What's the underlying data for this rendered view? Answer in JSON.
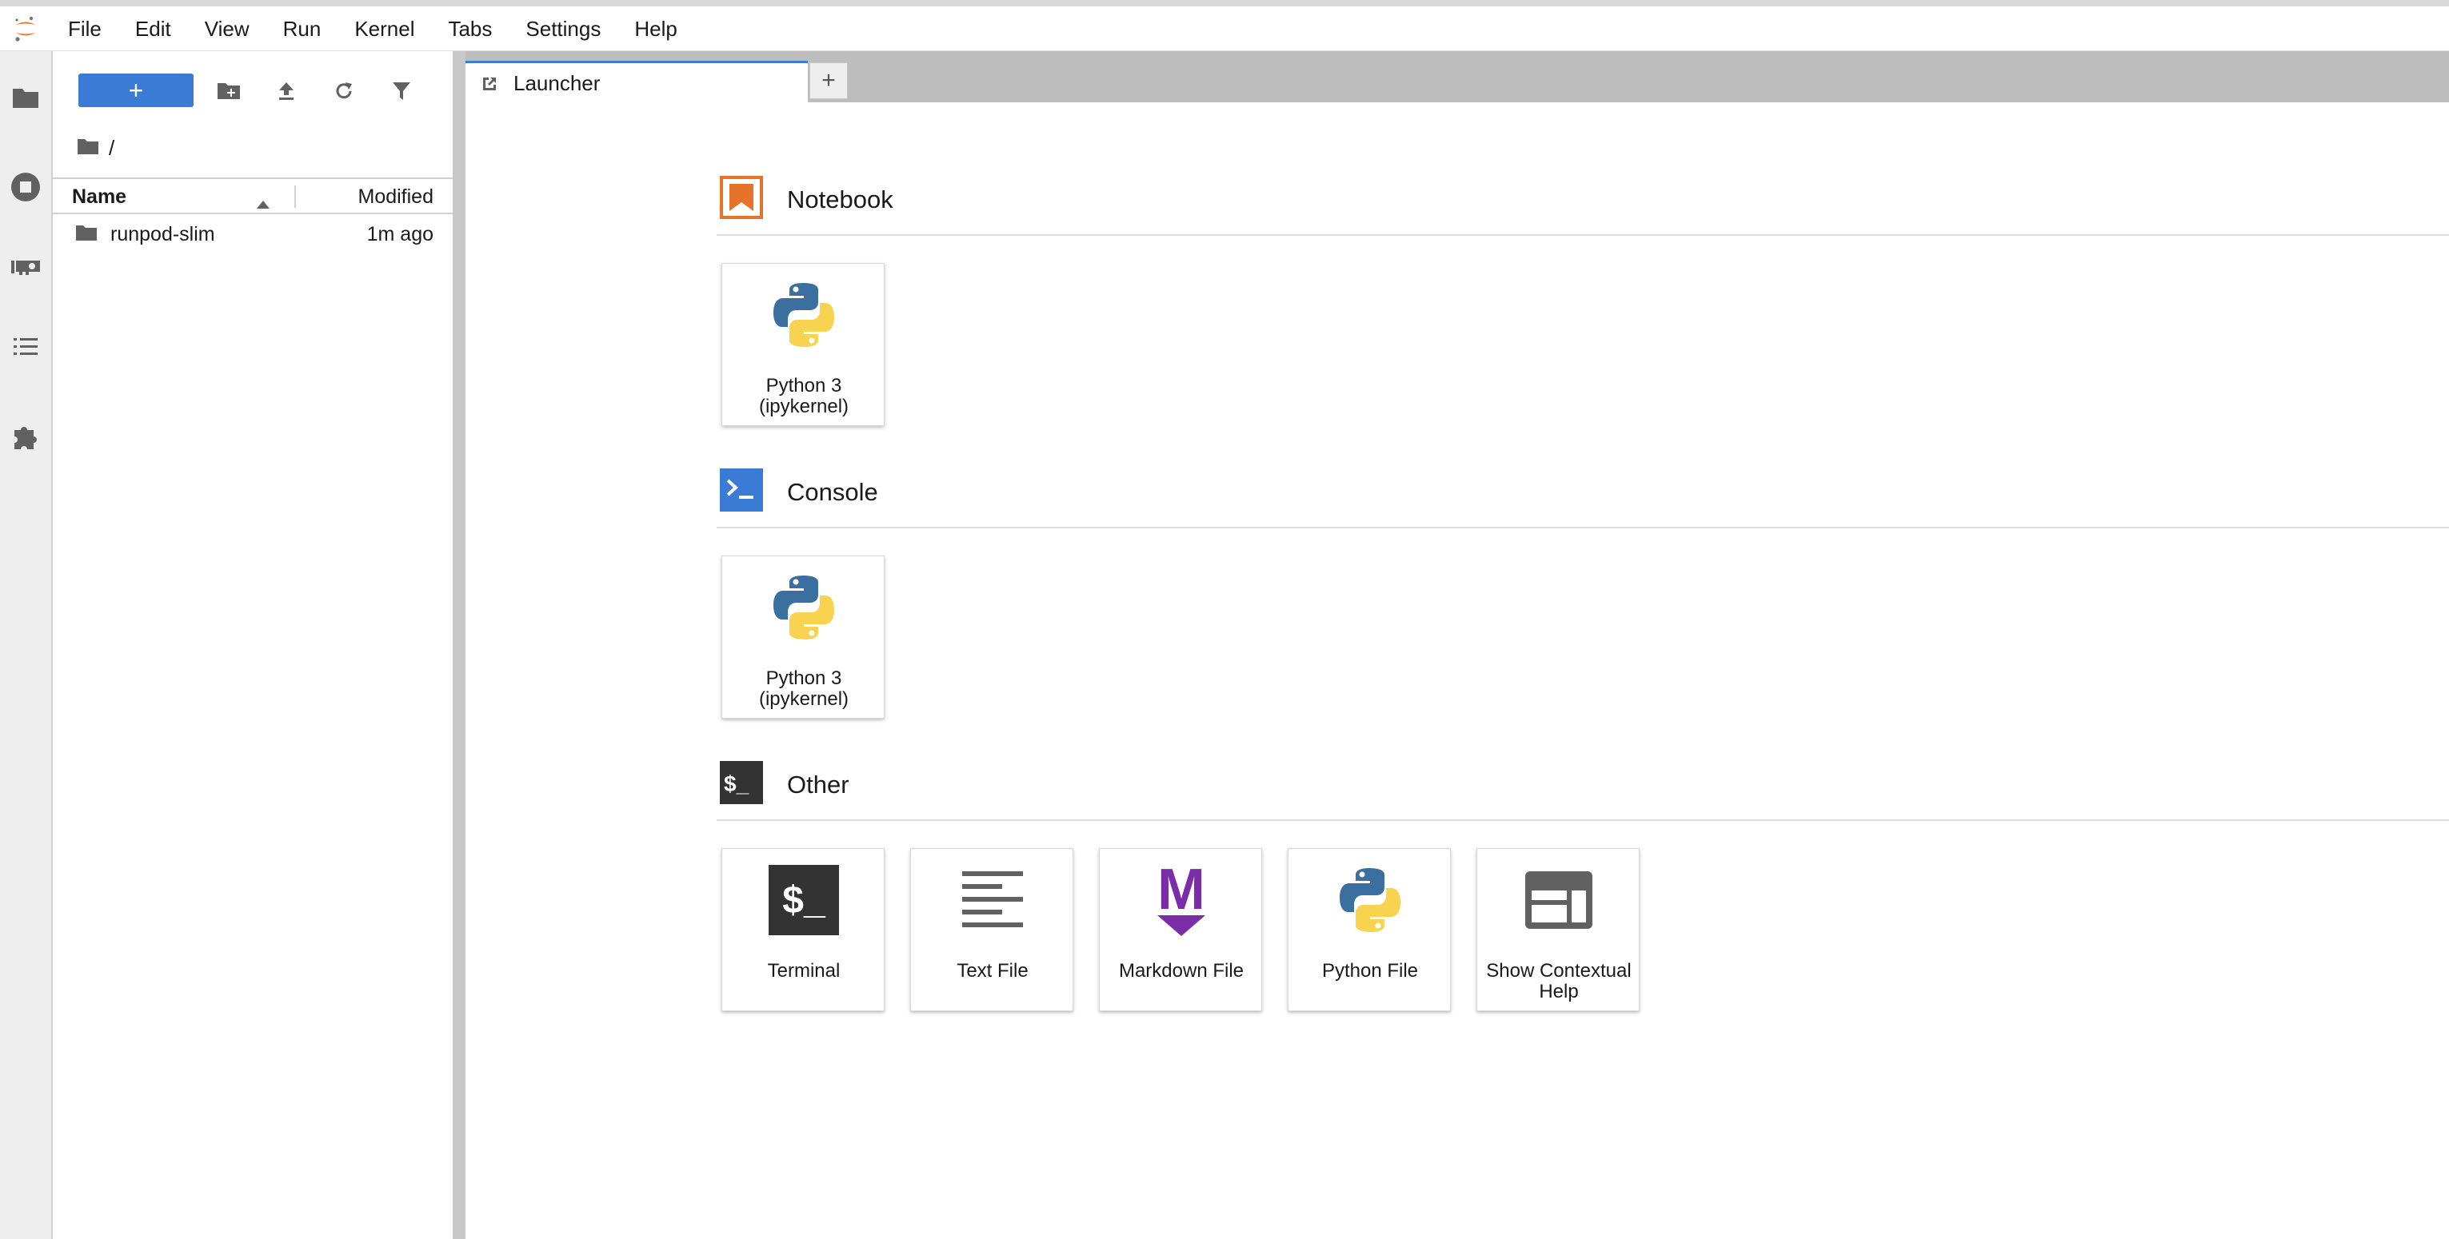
{
  "menubar": {
    "items": [
      "File",
      "Edit",
      "View",
      "Run",
      "Kernel",
      "Tabs",
      "Settings",
      "Help"
    ]
  },
  "activity_bar": {
    "icons": [
      "folder-icon",
      "running-sessions-icon",
      "gpu-icon",
      "table-of-contents-icon",
      "extension-icon"
    ]
  },
  "file_browser": {
    "new_button_label": "+",
    "breadcrumb": "/",
    "columns": {
      "name": "Name",
      "modified": "Modified"
    },
    "files": [
      {
        "name": "runpod-slim",
        "modified": "1m ago",
        "type": "folder"
      }
    ]
  },
  "tabs": [
    {
      "label": "Launcher"
    }
  ],
  "add_tab_label": "+",
  "launcher": {
    "sections": [
      {
        "title": "Notebook",
        "cards": [
          {
            "label": "Python 3 (ipykernel)"
          }
        ]
      },
      {
        "title": "Console",
        "cards": [
          {
            "label": "Python 3 (ipykernel)"
          }
        ]
      },
      {
        "title": "Other",
        "cards": [
          {
            "label": "Terminal"
          },
          {
            "label": "Text File"
          },
          {
            "label": "Markdown File"
          },
          {
            "label": "Python File"
          },
          {
            "label": "Show Contextual Help"
          }
        ]
      }
    ],
    "terminal_icon_text": "$_",
    "markdown_icon_text": "M"
  },
  "colors": {
    "accent": "#3a7bd5",
    "notebook_orange": "#e67329",
    "console_blue": "#3a7bd5",
    "other_dark": "#444444",
    "markdown_purple": "#7b2da8"
  }
}
